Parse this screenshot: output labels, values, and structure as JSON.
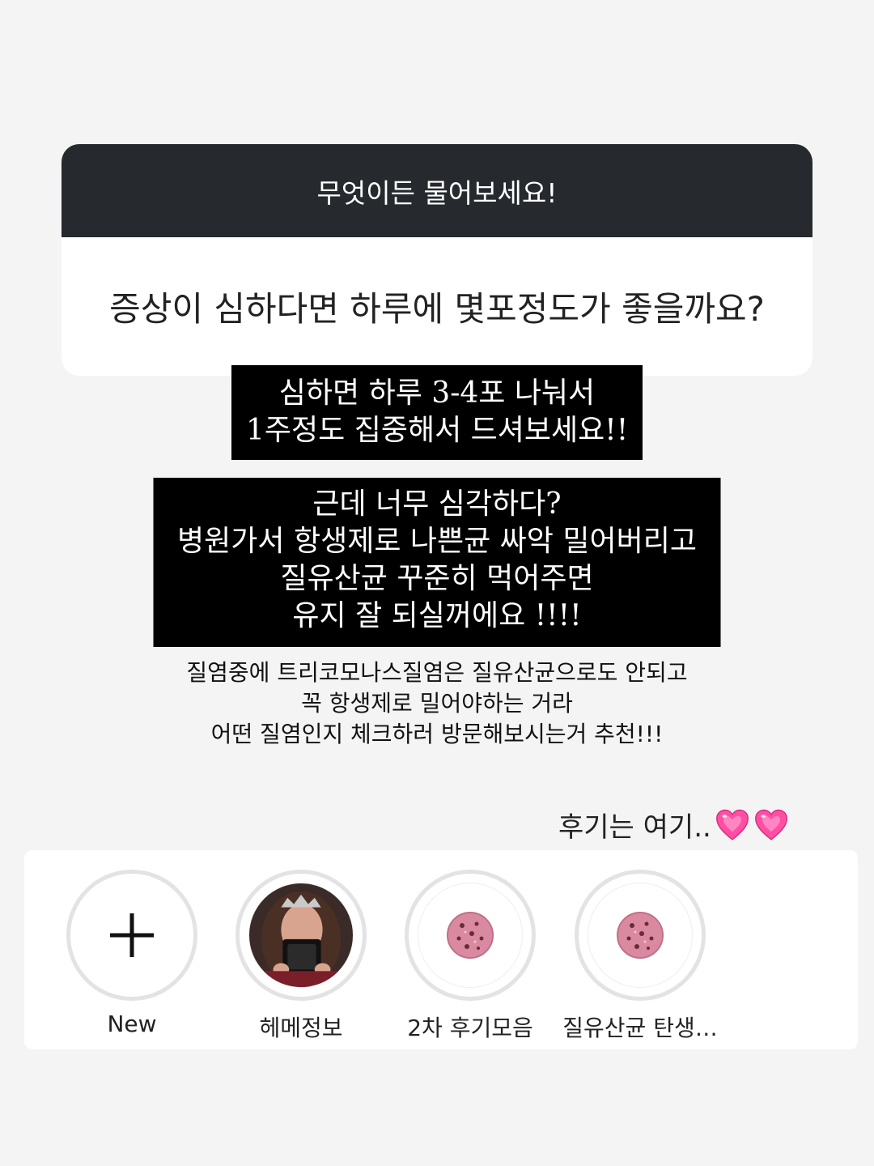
{
  "question_card": {
    "header": "무엇이든 물어보세요!",
    "question": "증상이 심하다면 하루에 몇포정도가 좋을까요?"
  },
  "answers": [
    {
      "lines": [
        "심하면 하루 3-4포 나눠서",
        "1주정도 집중해서 드셔보세요!!"
      ]
    },
    {
      "lines": [
        "근데 너무 심각하다?",
        "병원가서 항생제로 나쁜균 싸악 밀어버리고",
        "질유산균 꾸준히 먹어주면",
        "유지 잘 되실꺼에요 !!!!"
      ]
    }
  ],
  "note": {
    "lines": [
      "질염중에 트리코모나스질염은 질유산균으로도 안되고",
      "꼭 항생제로 밀어야하는 거라",
      "어떤 질염인지 체크하러 방문해보시는거 추천!!!"
    ]
  },
  "reviews_label": "후기는 여기..",
  "reviews_icons": [
    "pink-heart-icon",
    "pink-heart-icon"
  ],
  "highlights": [
    {
      "label": "New",
      "icon": "plus-icon"
    },
    {
      "label": "헤메정보",
      "icon": "profile-photo"
    },
    {
      "label": "2차 후기모음",
      "icon": "cookie-icon"
    },
    {
      "label": "질유산균 탄생…",
      "icon": "cookie-icon"
    }
  ],
  "colors": {
    "background": "#f4f4f4",
    "header_bg": "#262a2e",
    "answer_bg": "#000000",
    "heart": "#ff4fa3",
    "ring": "#e3e3e3"
  }
}
